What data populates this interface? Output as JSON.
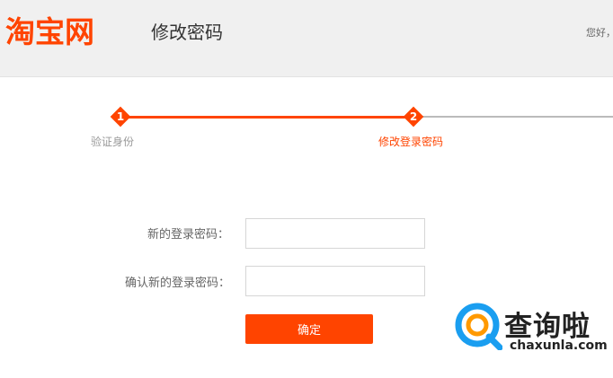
{
  "header": {
    "logo_text": "淘宝网",
    "page_title": "修改密码",
    "greeting": "您好，"
  },
  "steps": [
    {
      "number": "1",
      "label": "验证身份",
      "state": "done"
    },
    {
      "number": "2",
      "label": "修改登录密码",
      "state": "current"
    }
  ],
  "form": {
    "new_password_label": "新的登录密码：",
    "confirm_password_label": "确认新的登录密码：",
    "new_password_value": "",
    "confirm_password_value": "",
    "submit_label": "确定"
  },
  "watermark": {
    "chinese": "查询啦",
    "domain": "chaxunla.com"
  },
  "colors": {
    "brand": "#ff4400",
    "header_bg": "#f0f0f0",
    "inactive_line": "#bbbbbb",
    "watermark_blue": "#1a9ef0",
    "watermark_orange": "#ff9900"
  }
}
